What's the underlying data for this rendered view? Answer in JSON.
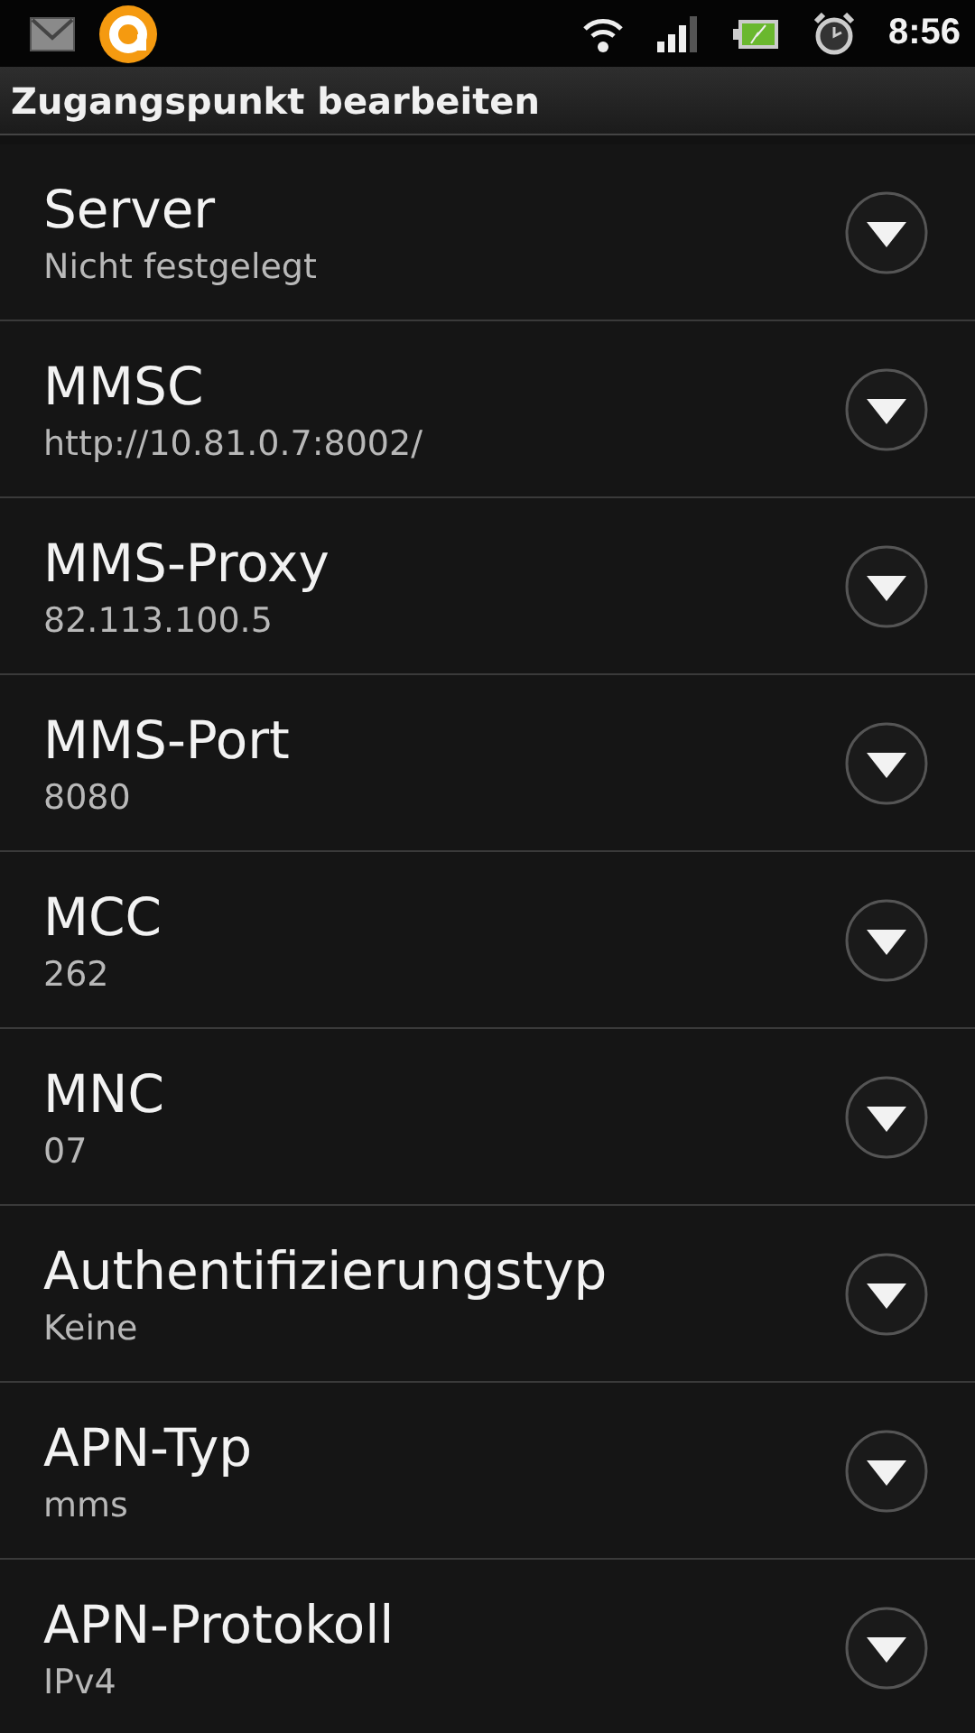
{
  "status_bar": {
    "time": "8:56"
  },
  "title": "Zugangspunkt bearbeiten",
  "settings": [
    {
      "label": "Server",
      "value": "Nicht festgelegt"
    },
    {
      "label": "MMSC",
      "value": "http://10.81.0.7:8002/"
    },
    {
      "label": "MMS-Proxy",
      "value": "82.113.100.5"
    },
    {
      "label": "MMS-Port",
      "value": "8080"
    },
    {
      "label": "MCC",
      "value": "262"
    },
    {
      "label": "MNC",
      "value": "07"
    },
    {
      "label": "Authentifizierungstyp",
      "value": "Keine"
    },
    {
      "label": "APN-Typ",
      "value": "mms"
    },
    {
      "label": "APN-Protokoll",
      "value": "IPv4"
    }
  ]
}
